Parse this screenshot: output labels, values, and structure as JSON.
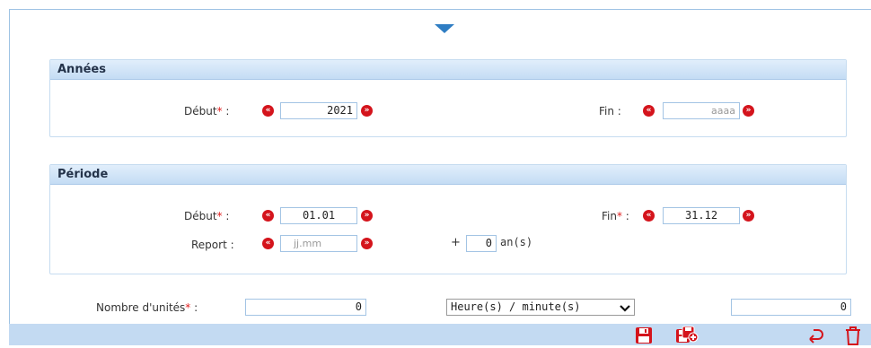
{
  "years": {
    "title": "Années",
    "start_label": "Début",
    "start_value": "2021",
    "end_label": "Fin :",
    "end_placeholder": "aaaa"
  },
  "period": {
    "title": "Période",
    "start_label": "Début",
    "start_value": "01.01",
    "end_label": "Fin",
    "end_value": "31.12",
    "report_label": "Report :",
    "report_placeholder": "jj.mm",
    "plus_label": "+",
    "years_offset_value": "0",
    "years_unit_label": "an(s)"
  },
  "units": {
    "label": "Nombre d'unités",
    "value": "0",
    "unit_select": "Heure(s) / minute(s)",
    "minutes_value": "0"
  },
  "common": {
    "required_mark": "*",
    "colon": ":",
    "prev_glyph": "«",
    "next_glyph": "»"
  },
  "colors": {
    "accent": "#2f7dc3",
    "nav_button": "#d4141c",
    "footer_bg": "#c3daf2"
  },
  "icons": {
    "collapse": "caret-down-icon",
    "save": "save-icon",
    "save_new": "save-add-icon",
    "undo": "undo-icon",
    "delete": "trash-icon"
  }
}
